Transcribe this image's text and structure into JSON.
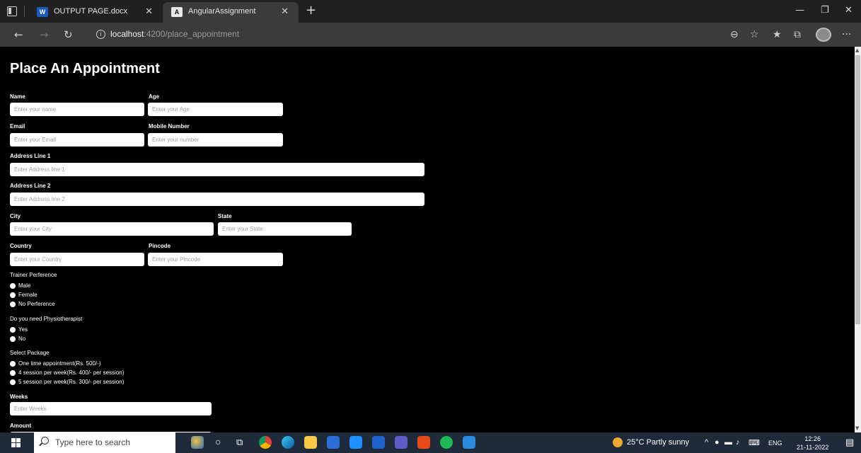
{
  "browser": {
    "tabs": [
      {
        "label": "OUTPUT PAGE.docx",
        "icon": "word-icon",
        "icon_text": "W"
      },
      {
        "label": "AngularAssignment",
        "icon": "angular-icon",
        "icon_text": "A"
      }
    ],
    "url_host": "localhost",
    "url_path": ":4200/place_appointment",
    "info_glyph": "i"
  },
  "form": {
    "title": "Place An Appointment",
    "name_label": "Name",
    "name_placeholder": "Enter your name",
    "age_label": "Age",
    "age_placeholder": "Enter your Age",
    "email_label": "Email",
    "email_placeholder": "Enter your Email",
    "mobile_label": "Mobile Number",
    "mobile_placeholder": "Enter your number",
    "address1_label": "Address Line 1",
    "address1_placeholder": "Enter Address line 1",
    "address2_label": "Address Line 2",
    "address2_placeholder": "Enter Address line 2",
    "city_label": "City",
    "city_placeholder": "Enter your City",
    "state_label": "State",
    "state_placeholder": "Enter your State",
    "country_label": "Country",
    "country_placeholder": "Enter your Country",
    "pincode_label": "Pincode",
    "pincode_placeholder": "Enter your Pincode",
    "trainer_label": "Trainer Perference",
    "trainer_options": [
      "Male",
      "Female",
      "No Perference"
    ],
    "physio_label": "Do you need Physiotherapist",
    "physio_options": [
      "Yes",
      "No"
    ],
    "package_label": "Select Package",
    "package_options": [
      "One time appointment(Rs. 500/-)",
      "4 session per week(Rs. 400/- per session)",
      "5 session per week(Rs. 300/- per session)"
    ],
    "weeks_label": "Weeks",
    "weeks_placeholder": "Enter Weeks",
    "amount_label": "Amount"
  },
  "taskbar": {
    "search_placeholder": "Type here to search",
    "weather": "25°C  Partly sunny",
    "language": "ENG",
    "time": "12:26",
    "date": "21-11-2022"
  }
}
